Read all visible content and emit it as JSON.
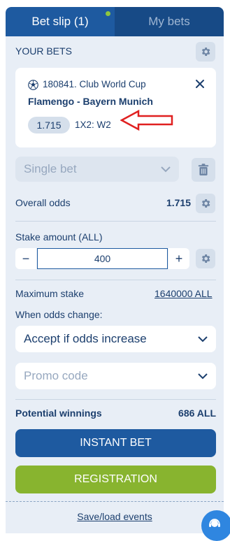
{
  "tabs": [
    {
      "label": "Bet slip (1)",
      "active": true
    },
    {
      "label": "My bets",
      "active": false
    }
  ],
  "your_bets_label": "YOUR BETS",
  "bet": {
    "event_id": "180841. Club World Cup",
    "match": "Flamengo - Bayern Munich",
    "odds": "1.715",
    "market": "1X2: W2"
  },
  "bet_type": {
    "selected": "Single bet"
  },
  "overall_odds": {
    "label": "Overall odds",
    "value": "1.715"
  },
  "stake": {
    "label": "Stake amount (ALL)",
    "value": "400",
    "minus": "−",
    "plus": "+"
  },
  "max_stake": {
    "label": "Maximum stake",
    "value": "1640000 ALL"
  },
  "odds_change": {
    "label": "When odds change:",
    "selected": "Accept if odds increase"
  },
  "promo": {
    "placeholder": "Promo code"
  },
  "potential_winnings": {
    "label": "Potential winnings",
    "value": "686 ALL"
  },
  "buttons": {
    "instant_bet": "INSTANT BET",
    "registration": "REGISTRATION"
  },
  "save_load": "Save/load events",
  "colors": {
    "primary": "#1e5aa0",
    "tab_dark": "#174a86",
    "green": "#88b42f",
    "panel_bg": "#e8eef6",
    "annotation_arrow": "#e02020"
  }
}
